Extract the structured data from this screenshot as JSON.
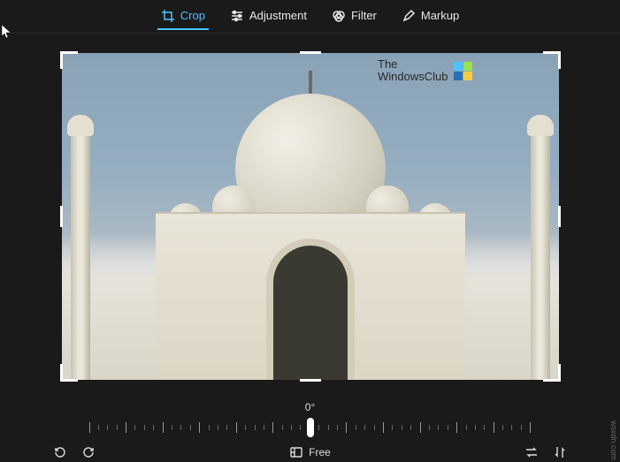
{
  "tabs": {
    "crop": "Crop",
    "adjustment": "Adjustment",
    "filter": "Filter",
    "markup": "Markup"
  },
  "watermark": {
    "line1": "The",
    "line2": "WindowsClub"
  },
  "rotation": {
    "value": "0",
    "unit": "°"
  },
  "aspect": {
    "label": "Free"
  },
  "attribution": "wsxdn.com"
}
